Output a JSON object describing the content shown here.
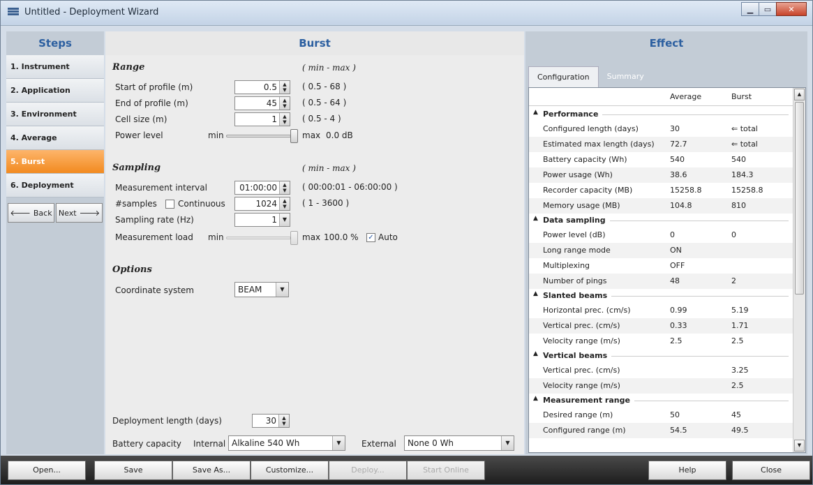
{
  "window": {
    "title": "Untitled - Deployment Wizard"
  },
  "steps": {
    "header": "Steps",
    "items": [
      "1. Instrument",
      "2. Application",
      "3. Environment",
      "4. Average",
      "5. Burst",
      "6. Deployment"
    ],
    "active_index": 4,
    "back_label": "Back",
    "next_label": "Next"
  },
  "burst": {
    "header": "Burst",
    "range": {
      "title": "Range",
      "minmax": "( min - max )",
      "start_label": "Start of profile (m)",
      "start_value": "0.5",
      "start_range": "( 0.5 - 68 )",
      "end_label": "End of profile (m)",
      "end_value": "45",
      "end_range": "( 0.5 - 64 )",
      "cell_label": "Cell size (m)",
      "cell_value": "1",
      "cell_range": "( 0.5 - 4 )",
      "power_label": "Power level",
      "power_min": "min",
      "power_max": "max",
      "power_value": "0.0 dB",
      "power_level": 1.0
    },
    "sampling": {
      "title": "Sampling",
      "minmax": "( min - max )",
      "interval_label": "Measurement interval",
      "interval_value": "01:00:00",
      "interval_range": "( 00:00:01 - 06:00:00 )",
      "samples_label": "#samples",
      "continuous_label": "Continuous",
      "continuous_checked": false,
      "samples_value": "1024",
      "samples_range": "( 1 - 3600 )",
      "rate_label": "Sampling rate (Hz)",
      "rate_value": "1",
      "load_label": "Measurement load",
      "load_min": "min",
      "load_max": "max",
      "load_value": "100.0 %",
      "auto_label": "Auto",
      "auto_checked": true,
      "load_level": 1.0
    },
    "options": {
      "title": "Options",
      "coord_label": "Coordinate system",
      "coord_value": "BEAM"
    },
    "deployment_length_label": "Deployment length (days)",
    "deployment_length_value": "30",
    "battery_label": "Battery capacity",
    "internal_label": "Internal",
    "internal_value": "Alkaline 540 Wh",
    "external_label": "External",
    "external_value": "None 0 Wh"
  },
  "effect": {
    "header": "Effect",
    "tabs": [
      "Configuration",
      "Summary"
    ],
    "columns": [
      "Average",
      "Burst"
    ],
    "groups": [
      {
        "title": "Performance",
        "rows": [
          [
            "Configured length (days)",
            "30",
            "⇐ total"
          ],
          [
            "Estimated max length (days)",
            "72.7",
            "⇐ total"
          ],
          [
            "Battery capacity (Wh)",
            "540",
            "540"
          ],
          [
            "Power usage (Wh)",
            "38.6",
            "184.3"
          ],
          [
            "Recorder capacity (MB)",
            "15258.8",
            "15258.8"
          ],
          [
            "Memory usage (MB)",
            "104.8",
            "810"
          ]
        ]
      },
      {
        "title": "Data sampling",
        "rows": [
          [
            "Power level (dB)",
            "0",
            "0"
          ],
          [
            "Long range mode",
            "ON",
            ""
          ],
          [
            "Multiplexing",
            "OFF",
            ""
          ],
          [
            "Number of pings",
            "48",
            "2"
          ]
        ]
      },
      {
        "title": "Slanted beams",
        "rows": [
          [
            "Horizontal prec. (cm/s)",
            "0.99",
            "5.19"
          ],
          [
            "Vertical prec. (cm/s)",
            "0.33",
            "1.71"
          ],
          [
            "Velocity range (m/s)",
            "2.5",
            "2.5"
          ]
        ]
      },
      {
        "title": "Vertical beams",
        "rows": [
          [
            "Vertical prec. (cm/s)",
            "",
            "3.25"
          ],
          [
            "Velocity range (m/s)",
            "",
            "2.5"
          ]
        ]
      },
      {
        "title": "Measurement range",
        "rows": [
          [
            "Desired range (m)",
            "50",
            "45"
          ],
          [
            "Configured range (m)",
            "54.5",
            "49.5"
          ]
        ]
      }
    ]
  },
  "bottom": {
    "open": "Open...",
    "save": "Save",
    "save_as": "Save As...",
    "customize": "Customize...",
    "deploy": "Deploy...",
    "start_online": "Start Online",
    "help": "Help",
    "close": "Close"
  }
}
